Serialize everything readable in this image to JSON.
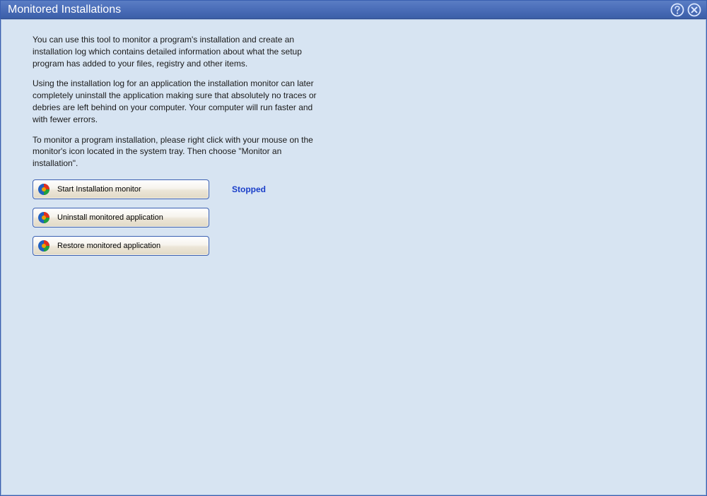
{
  "window": {
    "title": "Monitored Installations"
  },
  "intro": {
    "p1": "You can use this tool to monitor a program's installation and create an installation log which contains detailed information about what the setup program has added to your files, registry and other items.",
    "p2": "Using the installation log for an application the installation monitor can later completely uninstall the application making sure that absolutely no traces or debries are left behind on your computer. Your computer will run faster and with fewer errors.",
    "p3": "To monitor a program installation, please right click with your mouse on the monitor's icon located in the system tray. Then choose \"Monitor an installation\"."
  },
  "buttons": {
    "start": "Start Installation monitor",
    "uninstall": "Uninstall monitored application",
    "restore": "Restore monitored application"
  },
  "status": {
    "label": "Stopped"
  }
}
